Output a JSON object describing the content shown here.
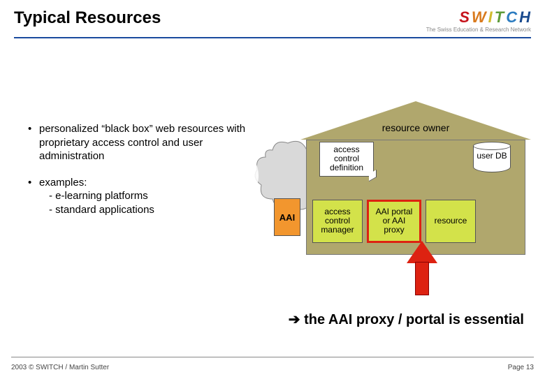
{
  "header": {
    "title": "Typical Resources",
    "logo_letters": [
      "S",
      "W",
      "I",
      "T",
      "C",
      "H"
    ],
    "logo_subtitle": "The Swiss Education & Research Network"
  },
  "bullets": {
    "item1": "personalized “black box” web resources with proprietary access control and user administration",
    "item2_head": "examples:",
    "item2_sub1": "- e-learning platforms",
    "item2_sub2": "- standard applications"
  },
  "diagram": {
    "roof_label": "resource owner",
    "acd": "access control definition",
    "db": "user DB",
    "aai": "AAI",
    "acm": "access control manager",
    "portal": "AAI portal or AAI proxy",
    "resource": "resource"
  },
  "conclusion": {
    "arrow": "➔",
    "text": " the AAI proxy / portal is essential"
  },
  "footer": {
    "left": "2003 © SWITCH / Martin Sutter",
    "right": "Page 13"
  }
}
